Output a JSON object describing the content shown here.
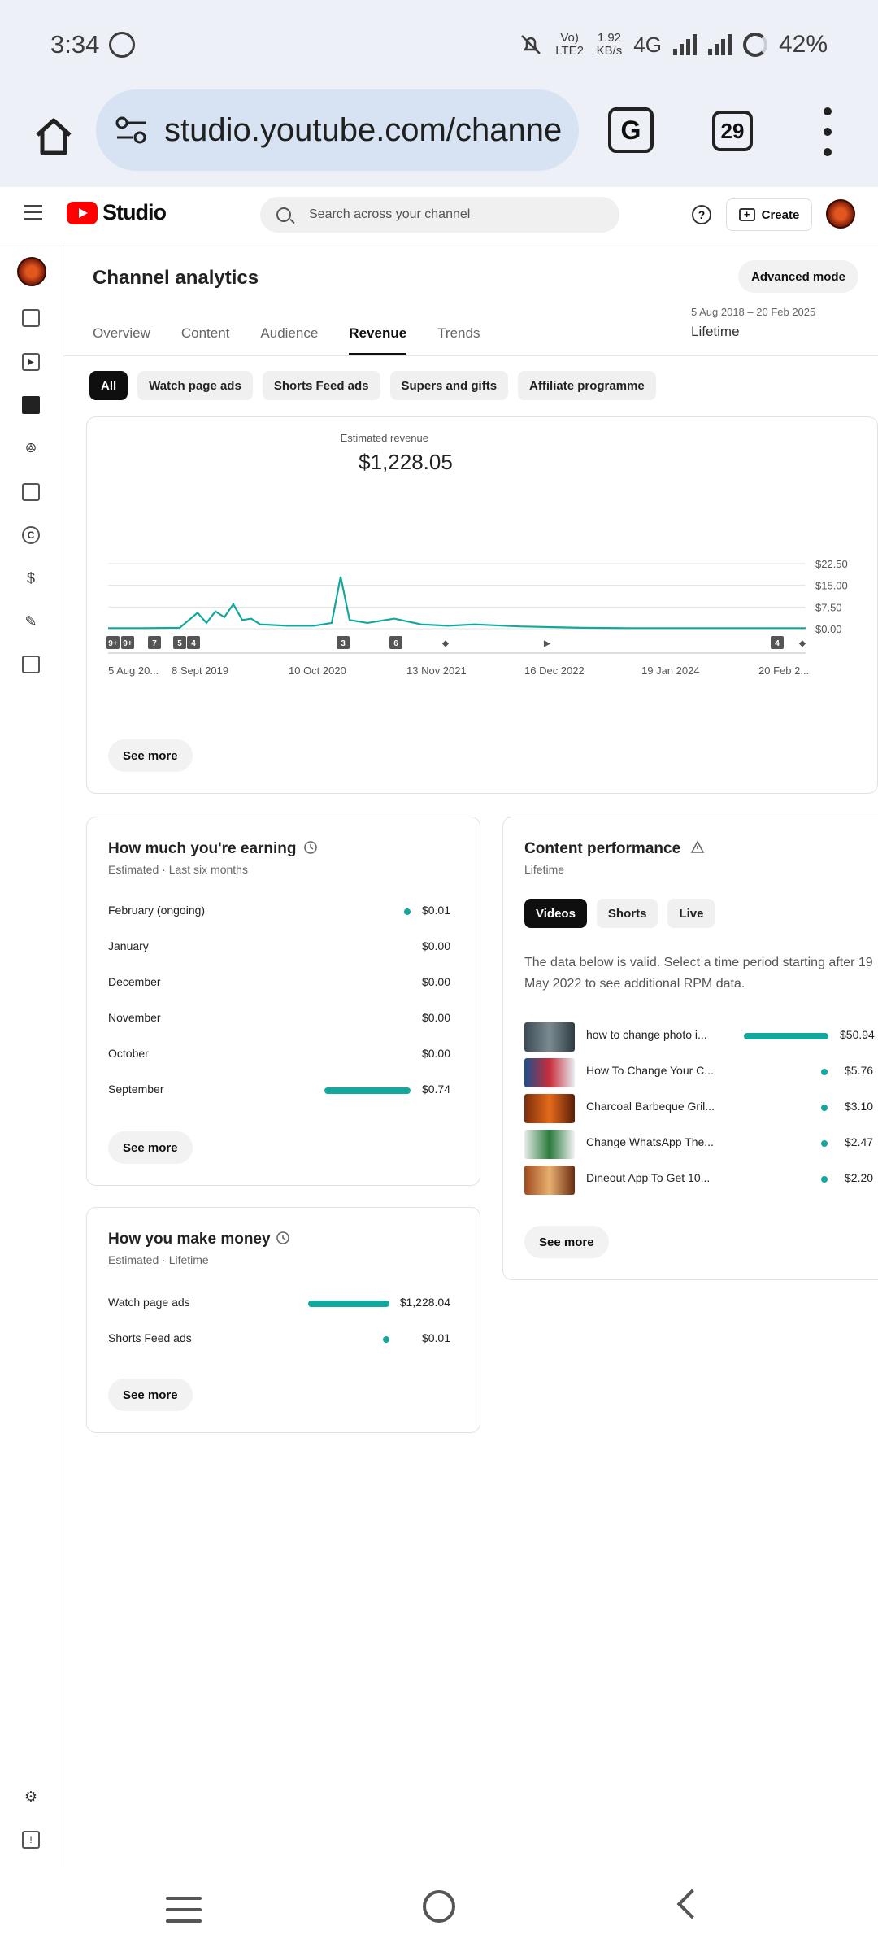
{
  "status_bar": {
    "time": "3:34",
    "network_small": "Vo) LTE2",
    "speed_value": "1.92",
    "speed_unit": "KB/s",
    "network": "4G",
    "battery": "42%"
  },
  "browser": {
    "url": "studio.youtube.com/channe",
    "tabs_count": "29"
  },
  "header": {
    "logo_text": "Studio",
    "search_placeholder": "Search across your channel",
    "help_symbol": "?",
    "create_label": "Create"
  },
  "page": {
    "title": "Channel analytics",
    "advanced_mode": "Advanced mode",
    "date_range": "5 Aug 2018 – 20 Feb 2025",
    "date_label": "Lifetime"
  },
  "tabs": [
    "Overview",
    "Content",
    "Audience",
    "Revenue",
    "Trends"
  ],
  "active_tab": "Revenue",
  "chips": [
    "All",
    "Watch page ads",
    "Shorts Feed ads",
    "Supers and gifts",
    "Affiliate programme"
  ],
  "active_chip": "All",
  "revenue_card": {
    "title": "Estimated revenue",
    "value": "$1,228.05",
    "see_more": "See more"
  },
  "chart_data": {
    "type": "line",
    "title": "Estimated revenue",
    "x_tick_labels": [
      "5 Aug 20...",
      "8 Sept 2019",
      "10 Oct 2020",
      "13 Nov 2021",
      "16 Dec 2022",
      "19 Jan 2024",
      "20 Feb 2..."
    ],
    "y_tick_labels": [
      "$22.50",
      "$15.00",
      "$7.50",
      "$0.00"
    ],
    "ylim": [
      0,
      22.5
    ],
    "grid": true,
    "x": [
      "2018-08",
      "2018-12",
      "2019-04",
      "2019-06",
      "2019-07",
      "2019-08",
      "2019-09",
      "2019-10",
      "2019-11",
      "2019-12",
      "2020-01",
      "2020-04",
      "2020-07",
      "2020-09",
      "2020-10",
      "2020-11",
      "2021-01",
      "2021-04",
      "2021-07",
      "2021-10",
      "2022-01",
      "2022-06",
      "2023-01",
      "2023-06",
      "2024-01",
      "2024-06",
      "2025-02"
    ],
    "values": [
      0.2,
      0.2,
      0.3,
      5.5,
      2,
      6,
      4,
      8.5,
      3,
      3.5,
      1.5,
      1,
      1,
      2,
      18,
      3,
      2,
      3.5,
      1.5,
      1,
      1.5,
      0.8,
      0.3,
      0.2,
      0.2,
      0.2,
      0.2
    ],
    "markers": [
      "9+",
      "9+",
      "7",
      "5",
      "4",
      "3",
      "6",
      "short",
      "video",
      "4",
      "short"
    ],
    "series_color": "#12a89e"
  },
  "earning_card": {
    "title": "How much you're earning",
    "subtitle": "Estimated · Last six months",
    "see_more": "See more",
    "rows": [
      {
        "label": "February (ongoing)",
        "value": "$0.01"
      },
      {
        "label": "January",
        "value": "$0.00"
      },
      {
        "label": "December",
        "value": "$0.00"
      },
      {
        "label": "November",
        "value": "$0.00"
      },
      {
        "label": "October",
        "value": "$0.00"
      },
      {
        "label": "September",
        "value": "$0.74"
      }
    ]
  },
  "money_card": {
    "title": "How you make money",
    "subtitle": "Estimated · Lifetime",
    "see_more": "See more",
    "rows": [
      {
        "label": "Watch page ads",
        "value": "$1,228.04"
      },
      {
        "label": "Shorts Feed ads",
        "value": "$0.01"
      }
    ]
  },
  "content_card": {
    "title": "Content performance",
    "subtitle": "Lifetime",
    "tabs": [
      "Videos",
      "Shorts",
      "Live"
    ],
    "active_tab": "Videos",
    "note": "The data below is valid. Select a time period starting after 19 May 2022 to see additional RPM data.",
    "see_more": "See more",
    "rows": [
      {
        "label": "how to change photo i...",
        "value": "$50.94"
      },
      {
        "label": "How To Change Your C...",
        "value": "$5.76"
      },
      {
        "label": "Charcoal Barbeque Gril...",
        "value": "$3.10"
      },
      {
        "label": "Change WhatsApp The...",
        "value": "$2.47"
      },
      {
        "label": "Dineout App To Get 10...",
        "value": "$2.20"
      }
    ]
  }
}
